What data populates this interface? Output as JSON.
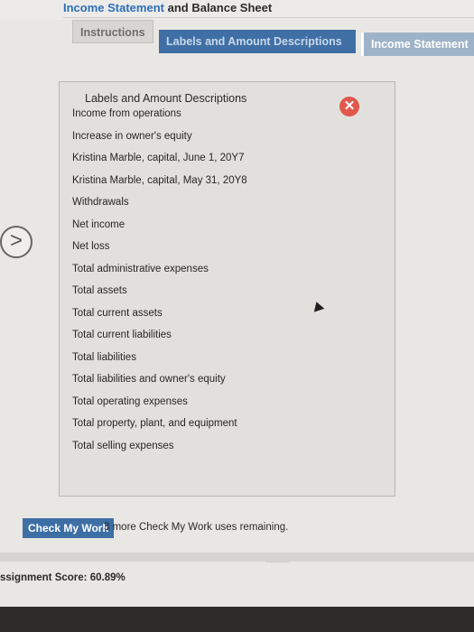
{
  "header": {
    "title_prefix": "Income Statement",
    "title_suffix": " and Balance Sheet"
  },
  "tabs": [
    {
      "label": "Instructions"
    },
    {
      "label": "Labels and Amount Descriptions"
    },
    {
      "label": "Income Statement"
    }
  ],
  "panel": {
    "title": "Labels and Amount Descriptions",
    "close_icon": "x-icon",
    "items": [
      "Income from operations",
      "Increase in owner's equity",
      "Kristina Marble, capital, June 1, 20Y7",
      "Kristina Marble, capital, May 31, 20Y8",
      "Withdrawals",
      "Net income",
      "Net loss",
      "Total administrative expenses",
      "Total assets",
      "Total current assets",
      "Total current liabilities",
      "Total liabilities",
      "Total liabilities and owner's equity",
      "Total operating expenses",
      "Total property, plant, and equipment",
      "Total selling expenses"
    ]
  },
  "footer": {
    "check_button": "Check My Work",
    "remaining_text": "3 more Check My Work uses remaining.",
    "score_label": "ssignment Score:",
    "score_value": "60.89%"
  },
  "colors": {
    "accent": "#3d6fa5",
    "close": "#e2574c"
  }
}
